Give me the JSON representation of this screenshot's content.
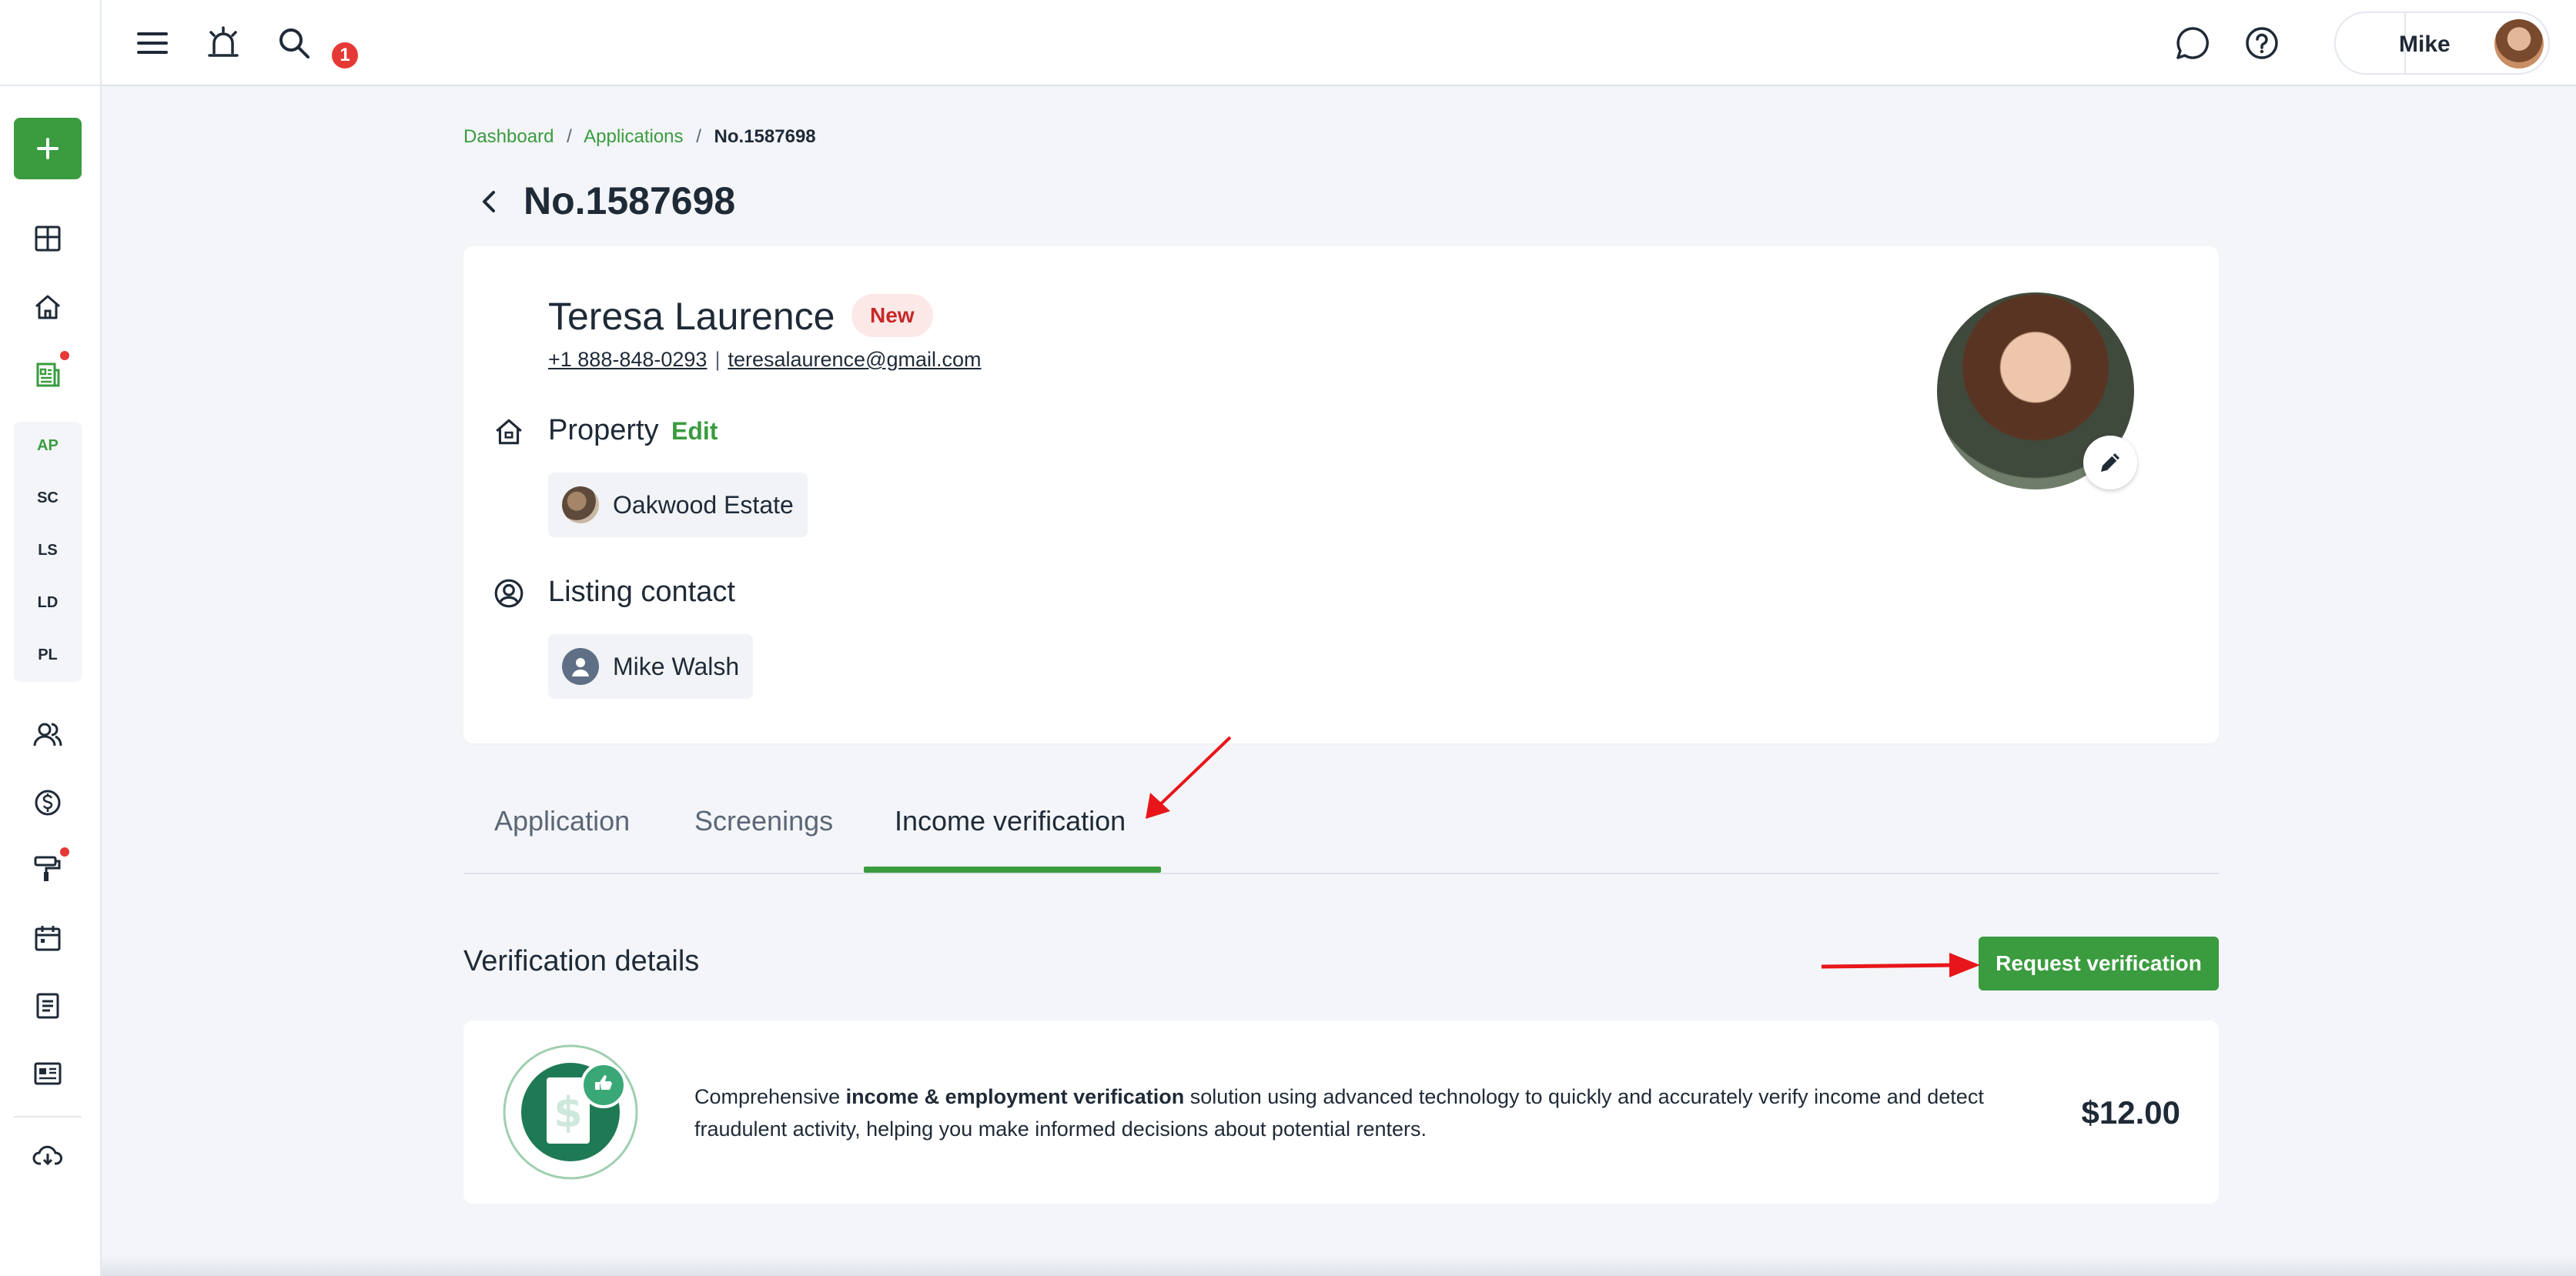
{
  "topbar": {
    "notification_count": "1",
    "user_name": "Mike"
  },
  "sidebar": {
    "items": [
      {
        "name": "dashboard"
      },
      {
        "name": "properties"
      },
      {
        "name": "applications"
      },
      {
        "name": "contacts"
      },
      {
        "name": "accounting"
      },
      {
        "name": "maintenance"
      },
      {
        "name": "calendar"
      },
      {
        "name": "reports"
      },
      {
        "name": "listings"
      },
      {
        "name": "downloads"
      }
    ],
    "sub_items": [
      "AP",
      "SC",
      "LS",
      "LD",
      "PL"
    ]
  },
  "breadcrumb": {
    "items": [
      "Dashboard",
      "Applications"
    ],
    "current": "No.1587698",
    "separator": "/"
  },
  "page": {
    "title": "No.1587698"
  },
  "applicant": {
    "name": "Teresa Laurence",
    "status": "New",
    "phone": "+1 888-848-0293",
    "separator": "|",
    "email": "teresalaurence@gmail.com"
  },
  "property": {
    "title": "Property",
    "edit_label": "Edit",
    "name": "Oakwood Estate"
  },
  "listing_contact": {
    "title": "Listing contact",
    "name": "Mike Walsh"
  },
  "tabs": [
    {
      "label": "Application",
      "active": false
    },
    {
      "label": "Screenings",
      "active": false
    },
    {
      "label": "Income verification",
      "active": true
    }
  ],
  "verification": {
    "section_title": "Verification details",
    "request_button": "Request verification",
    "desc_before": "Comprehensive ",
    "desc_bold": "income & employment verification",
    "desc_after": " solution using advanced technology to quickly and accurately verify income and detect fraudulent activity, helping you make informed decisions about potential renters.",
    "price": "$12.00"
  },
  "colors": {
    "accent": "#3a9b3f",
    "badge_red": "#e53935",
    "status_bg": "#fde8e8",
    "status_text": "#c62828",
    "annotation_arrow": "#e8161a"
  }
}
